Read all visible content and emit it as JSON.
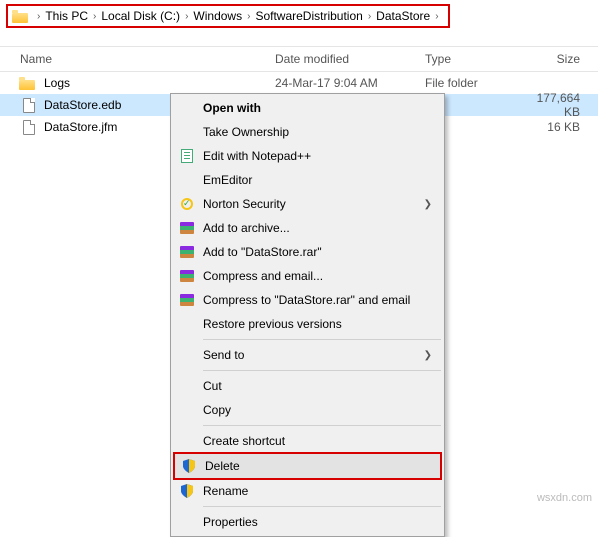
{
  "breadcrumb": {
    "items": [
      {
        "label": "This PC"
      },
      {
        "label": "Local Disk (C:)"
      },
      {
        "label": "Windows"
      },
      {
        "label": "SoftwareDistribution"
      },
      {
        "label": "DataStore"
      }
    ]
  },
  "columns": {
    "name": "Name",
    "date": "Date modified",
    "type": "Type",
    "size": "Size"
  },
  "files": [
    {
      "name": "Logs",
      "date": "24-Mar-17 9:04 AM",
      "type": "File folder",
      "size": "",
      "kind": "folder",
      "selected": false
    },
    {
      "name": "DataStore.edb",
      "date": "",
      "type": "",
      "size": "177,664 KB",
      "kind": "file",
      "selected": true
    },
    {
      "name": "DataStore.jfm",
      "date": "",
      "type": "",
      "size": "16 KB",
      "kind": "file",
      "selected": false
    }
  ],
  "menu": {
    "open_with": "Open with",
    "take_ownership": "Take Ownership",
    "edit_notepadpp": "Edit with Notepad++",
    "emeditor": "EmEditor",
    "norton": "Norton Security",
    "add_archive": "Add to archive...",
    "add_rar": "Add to \"DataStore.rar\"",
    "compress_email": "Compress and email...",
    "compress_rar_email": "Compress to \"DataStore.rar\" and email",
    "restore": "Restore previous versions",
    "send_to": "Send to",
    "cut": "Cut",
    "copy": "Copy",
    "create_shortcut": "Create shortcut",
    "delete": "Delete",
    "rename": "Rename",
    "properties": "Properties"
  },
  "watermark": "wsxdn.com"
}
